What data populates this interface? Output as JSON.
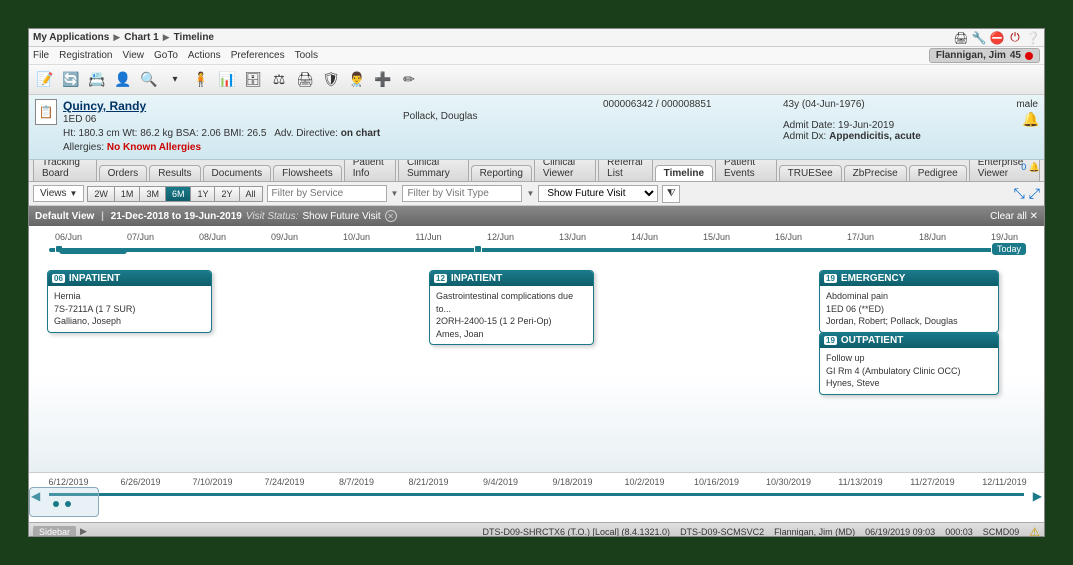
{
  "breadcrumb": [
    "My Applications",
    "Chart 1",
    "Timeline"
  ],
  "menu": {
    "items": [
      "File",
      "Registration",
      "View",
      "GoTo",
      "Actions",
      "Preferences",
      "Tools"
    ]
  },
  "userBadge": {
    "name": "Flannigan, Jim",
    "count": "45"
  },
  "patient": {
    "name": "Quincy, Randy",
    "location": "1ED 06",
    "vitals": "Ht: 180.3 cm   Wt: 86.2 kg   BSA: 2.06   BMI: 26.5",
    "advDirLabel": "Adv. Directive:",
    "advDirValue": "on chart",
    "allergiesLabel": "Allergies:",
    "allergiesValue": "No Known Allergies",
    "provider": "Pollack, Douglas",
    "ids": "000006342 / 000008851",
    "ageDob": "43y (04-Jun-1976)",
    "admitDate": "Admit Date: 19-Jun-2019",
    "admitDxLabel": "Admit Dx:",
    "admitDxValue": "Appendicitis, acute",
    "sex": "male"
  },
  "tabs": [
    "Tracking Board",
    "Orders",
    "Results",
    "Documents",
    "Flowsheets",
    "Patient Info",
    "Clinical Summary",
    "Reporting",
    "Clinical Viewer",
    "Referral List",
    "Timeline",
    "Patient Events",
    "TRUESee",
    "ZbPrecise",
    "Pedigree",
    "Enterprise Viewer"
  ],
  "activeTab": "Timeline",
  "filter": {
    "viewsLabel": "Views",
    "ranges": [
      "2W",
      "1M",
      "3M",
      "6M",
      "1Y",
      "2Y",
      "All"
    ],
    "activeRange": "6M",
    "servicePlaceholder": "Filter by Service",
    "visitTypePlaceholder": "Filter by Visit Type",
    "visitStatusValue": "Show Future Visit"
  },
  "darkStatus": {
    "viewLabel": "Default View",
    "range": "21-Dec-2018 to 19-Jun-2019",
    "visitStatusLabel": "Visit Status:",
    "visitStatusVal": "Show Future Visit",
    "clearAll": "Clear all"
  },
  "topScale": [
    "06/Jun",
    "07/Jun",
    "08/Jun",
    "09/Jun",
    "10/Jun",
    "11/Jun",
    "12/Jun",
    "13/Jun",
    "14/Jun",
    "15/Jun",
    "16/Jun",
    "17/Jun",
    "18/Jun",
    "19/Jun"
  ],
  "todayLabel": "Today",
  "cards": [
    {
      "date": "06",
      "type": "INPATIENT",
      "lines": [
        "Hernia",
        "7S-7211A (1 7 SUR)",
        "Galliano, Joseph"
      ]
    },
    {
      "date": "12",
      "type": "INPATIENT",
      "lines": [
        "Gastrointestinal complications due to...",
        "2ORH-2400-15 (1 2 Peri-Op)",
        "Ames, Joan"
      ]
    },
    {
      "date": "19",
      "type": "EMERGENCY",
      "lines": [
        "Abdominal pain",
        "1ED 06 (**ED)",
        "Jordan, Robert; Pollack, Douglas"
      ]
    },
    {
      "date": "19",
      "type": "OUTPATIENT",
      "lines": [
        "Follow up",
        "GI Rm 4 (Ambulatory Clinic OCC)",
        "Hynes, Steve"
      ]
    }
  ],
  "miniScale": [
    "6/12/2019",
    "6/26/2019",
    "7/10/2019",
    "7/24/2019",
    "8/7/2019",
    "8/21/2019",
    "9/4/2019",
    "9/18/2019",
    "10/2/2019",
    "10/16/2019",
    "10/30/2019",
    "11/13/2019",
    "11/27/2019",
    "12/11/2019"
  ],
  "bottomStatus": {
    "sidebar": "Sidebar",
    "server": "DTS-D09-SHRCTX6 (T.O.) [Local] (8.4.1321.0)",
    "server2": "DTS-D09-SCMSVC2",
    "user": "Flannigan, Jim (MD)",
    "datetime": "06/19/2019 09:03",
    "elapsed": "000:03",
    "env": "SCMD09"
  },
  "notifCount": "0"
}
